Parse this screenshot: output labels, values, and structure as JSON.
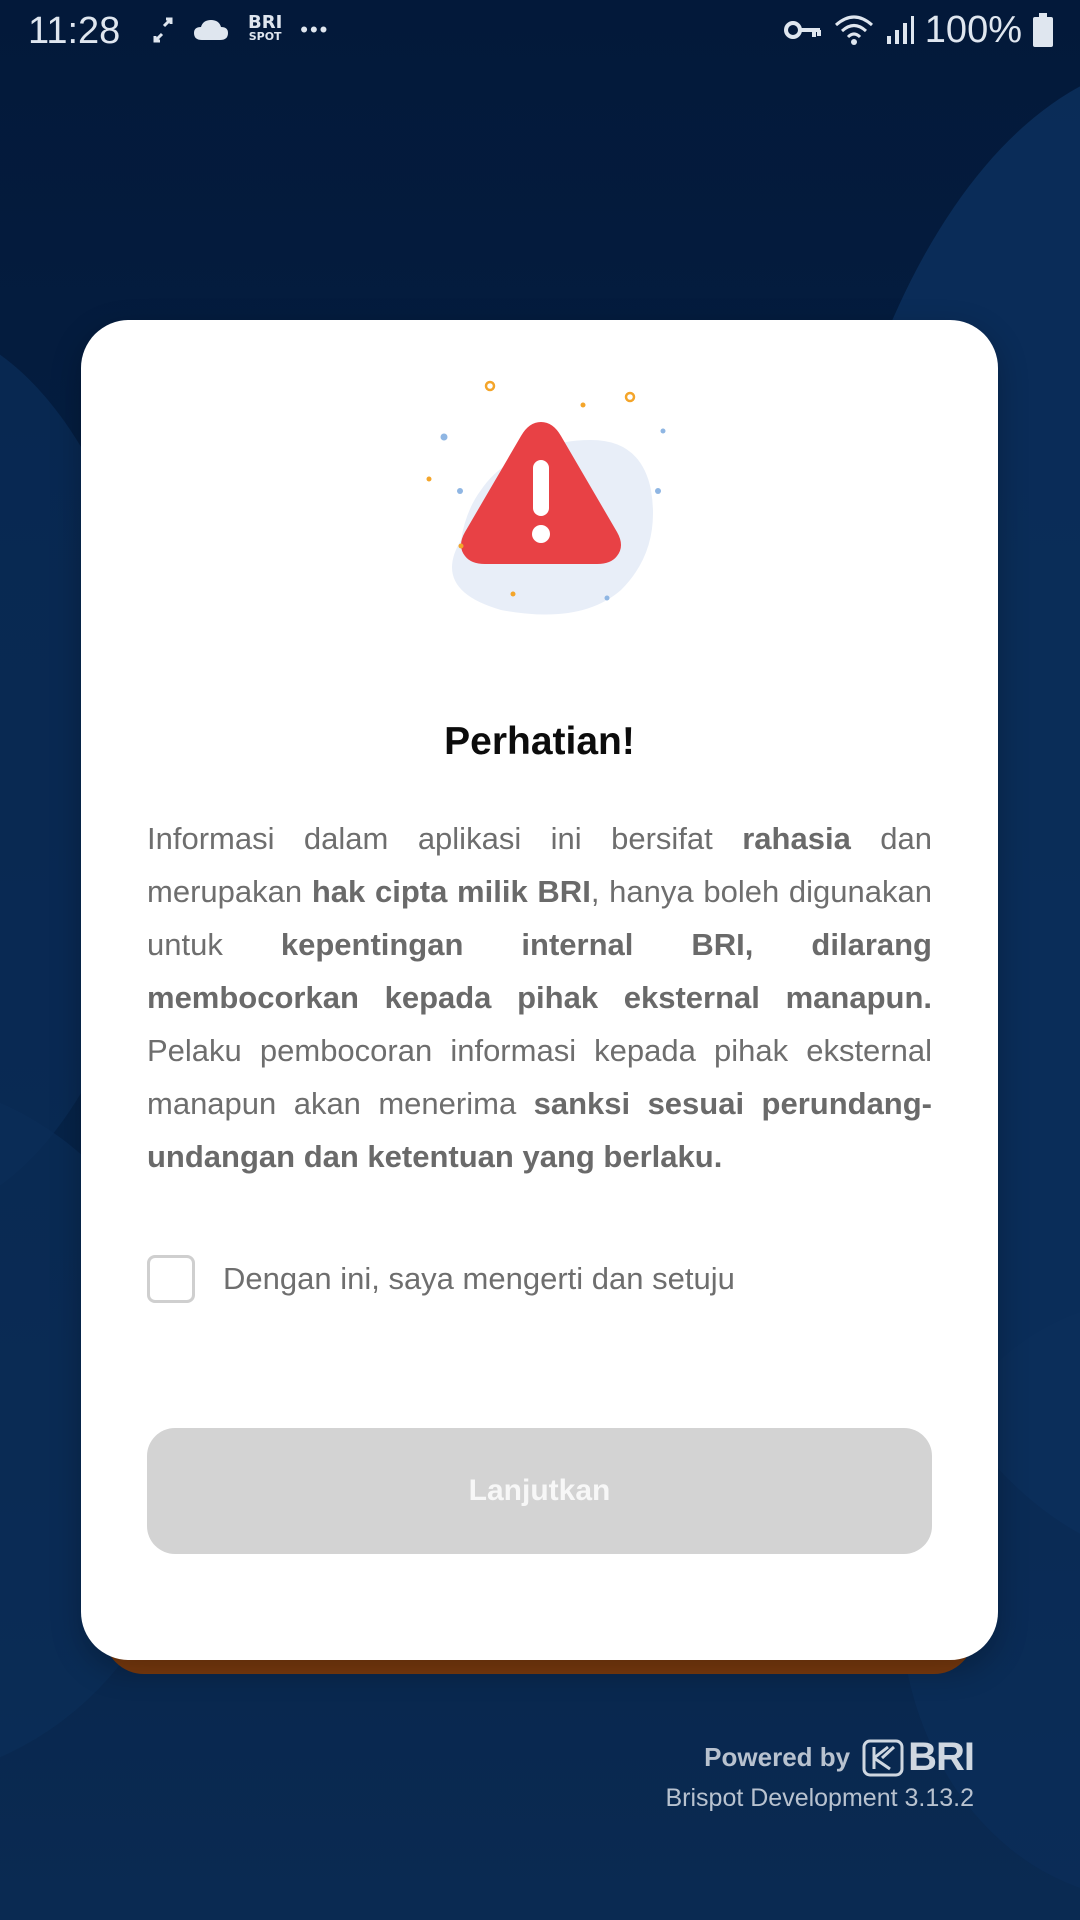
{
  "status_bar": {
    "time": "11:28",
    "battery_text": "100%",
    "app_badge_top": "BRI",
    "app_badge_bottom": "SPOT",
    "more": "•••"
  },
  "dialog": {
    "title": "Perhatian!",
    "paragraph": [
      {
        "text": "Informasi dalam aplikasi ini bersifat ",
        "bold": false
      },
      {
        "text": "rahasia",
        "bold": true
      },
      {
        "text": " dan merupakan ",
        "bold": false
      },
      {
        "text": "hak cipta milik BRI",
        "bold": true
      },
      {
        "text": ", hanya boleh digunakan untuk ",
        "bold": false
      },
      {
        "text": "kepentingan internal BRI, dilarang membocorkan kepada pihak eksternal manapun.",
        "bold": true
      },
      {
        "text": " Pelaku pembocoran informasi kepada pihak eksternal manapun akan menerima ",
        "bold": false
      },
      {
        "text": "sanksi sesuai perundang-undangan dan ketentuan yang berlaku.",
        "bold": true
      }
    ],
    "checkbox_label": "Dengan ini, saya mengerti dan setuju",
    "checkbox_checked": false,
    "continue_button": "Lanjutkan"
  },
  "footer": {
    "powered_by": "Powered by",
    "logo_text": "BRI",
    "version": "Brispot Development 3.13.2"
  },
  "colors": {
    "warning_red": "#e84145",
    "button_disabled": "#d3d3d3",
    "background": "#041d3f"
  }
}
